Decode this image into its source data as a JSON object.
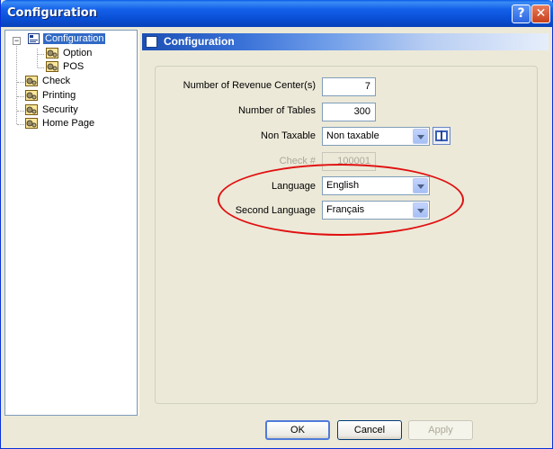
{
  "window": {
    "title": "Configuration",
    "help_glyph": "?",
    "close_glyph": "✕"
  },
  "tree": {
    "expander": "−",
    "items": [
      {
        "label": "Configuration",
        "icon": "config-icon",
        "selected": true
      },
      {
        "label": "Option",
        "icon": "gears-icon"
      },
      {
        "label": "POS",
        "icon": "gears-icon"
      },
      {
        "label": "Check",
        "icon": "gears-icon"
      },
      {
        "label": "Printing",
        "icon": "gears-icon"
      },
      {
        "label": "Security",
        "icon": "gears-icon"
      },
      {
        "label": "Home Page",
        "icon": "gears-icon"
      }
    ]
  },
  "panel": {
    "title": "Configuration"
  },
  "form": {
    "revenue_centers_label": "Number of Revenue Center(s)",
    "revenue_centers_value": "7",
    "tables_label": "Number of Tables",
    "tables_value": "300",
    "non_taxable_label": "Non Taxable",
    "non_taxable_value": "Non taxable",
    "check_label": "Check #",
    "check_value": "100001",
    "language_label": "Language",
    "language_value": "English",
    "second_language_label": "Second Language",
    "second_language_value": "Français"
  },
  "buttons": {
    "ok": "OK",
    "cancel": "Cancel",
    "apply": "Apply"
  },
  "colors": {
    "titlebar": "#0a4fd6",
    "selection": "#316ac5",
    "highlight_ellipse": "#e01010"
  }
}
